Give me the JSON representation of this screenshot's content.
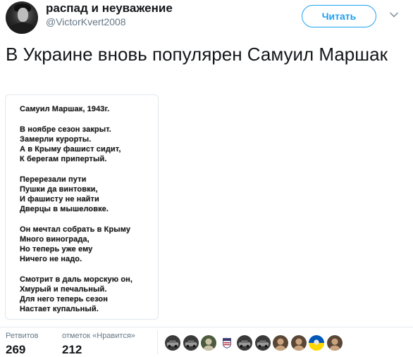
{
  "author": {
    "display_name": "распад и неуважение",
    "handle": "@VictorKvert2008",
    "avatar_icon": "profile-photo"
  },
  "follow_button": {
    "label": "Читать",
    "color": "#1da1f2"
  },
  "menu_icon": "chevron-down-icon",
  "tweet": {
    "text": "В Украине вновь популярен Самуил Маршак"
  },
  "poem_image": {
    "stanzas": [
      [
        "Самуил Маршак, 1943г."
      ],
      [
        "В ноябре сезон закрыт.",
        "Замерли курорты.",
        "А в Крыму фашист сидит,",
        "К берегам припертый."
      ],
      [
        "Перерезали пути",
        "Пушки да винтовки,",
        "И фашисту не найти",
        "Дверцы в мышеловке."
      ],
      [
        "Он мечтал собрать в Крыму",
        "Много винограда,",
        "Но теперь уже ему",
        "Ничего не надо."
      ],
      [
        "Смотрит в даль морскую он,",
        "Хмурый и печальный.",
        "Для него теперь сезон",
        "Настает купальный."
      ]
    ]
  },
  "stats": {
    "retweets": {
      "label": "Ретвитов",
      "value": "269"
    },
    "likes": {
      "label": "отметок «Нравится»",
      "value": "212"
    }
  },
  "likers": {
    "count_shown": 10,
    "avatar_icons": [
      "car-photo",
      "car-photo",
      "soldier-photo",
      "flag-badge",
      "car-photo",
      "car-photo",
      "person-photo",
      "person-photo",
      "ukraine-flag-photo",
      "person-photo"
    ]
  }
}
